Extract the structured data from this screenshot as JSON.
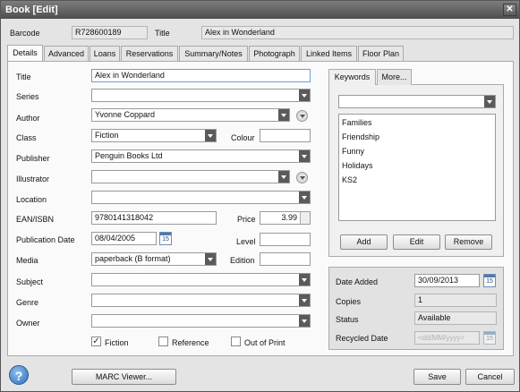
{
  "window": {
    "title": "Book [Edit]",
    "close_glyph": "✕"
  },
  "header": {
    "barcode_label": "Barcode",
    "barcode_value": "R728600189",
    "title_label": "Title",
    "title_value": "Alex in Wonderland"
  },
  "tabs": [
    "Details",
    "Advanced",
    "Loans",
    "Reservations",
    "Summary/Notes",
    "Photograph",
    "Linked Items",
    "Floor Plan"
  ],
  "form": {
    "title": {
      "label": "Title",
      "value": "Alex in Wonderland"
    },
    "series": {
      "label": "Series",
      "value": ""
    },
    "author": {
      "label": "Author",
      "value": "Yvonne Coppard"
    },
    "class": {
      "label": "Class",
      "value": "Fiction"
    },
    "colour": {
      "label": "Colour",
      "value": ""
    },
    "publisher": {
      "label": "Publisher",
      "value": "Penguin Books Ltd"
    },
    "illustrator": {
      "label": "Illustrator",
      "value": ""
    },
    "location": {
      "label": "Location",
      "value": ""
    },
    "ean": {
      "label": "EAN/ISBN",
      "value": "9780141318042"
    },
    "price": {
      "label": "Price",
      "value": "3.99"
    },
    "pubdate": {
      "label": "Publication Date",
      "value": "08/04/2005"
    },
    "level": {
      "label": "Level",
      "value": ""
    },
    "media": {
      "label": "Media",
      "value": "paperback (B format)"
    },
    "edition": {
      "label": "Edition",
      "value": ""
    },
    "subject": {
      "label": "Subject",
      "value": ""
    },
    "genre": {
      "label": "Genre",
      "value": ""
    },
    "owner": {
      "label": "Owner",
      "value": ""
    },
    "checks": [
      {
        "label": "Fiction",
        "checked": true,
        "mark": "✓"
      },
      {
        "label": "Reference",
        "checked": false,
        "mark": ""
      },
      {
        "label": "Out of Print",
        "checked": false,
        "mark": ""
      }
    ]
  },
  "keywords": {
    "tabs": [
      "Keywords",
      "More..."
    ],
    "dropdown_value": "",
    "items": [
      "Families",
      "Friendship",
      "Funny",
      "Holidays",
      "KS2"
    ],
    "buttons": {
      "add": "Add",
      "edit": "Edit",
      "remove": "Remove"
    }
  },
  "info": {
    "date_added_label": "Date Added",
    "date_added_value": "30/09/2013",
    "copies_label": "Copies",
    "copies_value": "1",
    "status_label": "Status",
    "status_value": "Available",
    "recycled_label": "Recycled Date",
    "recycled_placeholder": "<dd/MM/yyyy>"
  },
  "calendar_day": "15",
  "footer": {
    "help_glyph": "?",
    "marc_viewer": "MARC Viewer...",
    "save": "Save",
    "cancel": "Cancel"
  }
}
